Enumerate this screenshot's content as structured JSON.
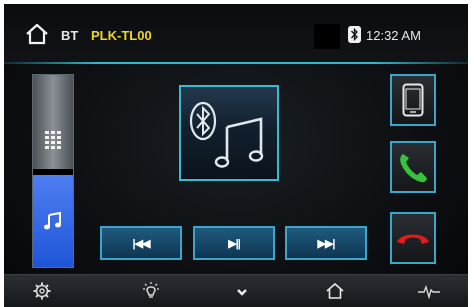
{
  "status_bar": {
    "source": "BT",
    "device_name": "PLK-TL00",
    "bluetooth_icon": "bluetooth-icon",
    "time": "12:32 AM"
  },
  "left_panel": {
    "keypad_icon": "keypad-grid-icon",
    "music_icon": "music-note-icon",
    "selected": "music"
  },
  "album_art": {
    "icon": "bluetooth-music-icon"
  },
  "playback_controls": {
    "previous_label": "|◀◀",
    "play_pause_label": "▶||",
    "next_label": "▶▶|"
  },
  "right_panel": {
    "phone_icon": "mobile-phone-icon",
    "answer_icon": "call-answer-icon",
    "hangup_icon": "call-hangup-icon"
  },
  "bottom_bar": {
    "items": [
      "settings-gear-icon",
      "brightness-icon",
      "chevron-down-icon",
      "home-icon",
      "equalizer-wave-icon"
    ]
  },
  "colors": {
    "accent": "#3aa6c9",
    "device_name": "#f0d52a",
    "music_button": "#2f65e6",
    "answer_green": "#36c23c",
    "hangup_red": "#e21b1b"
  }
}
